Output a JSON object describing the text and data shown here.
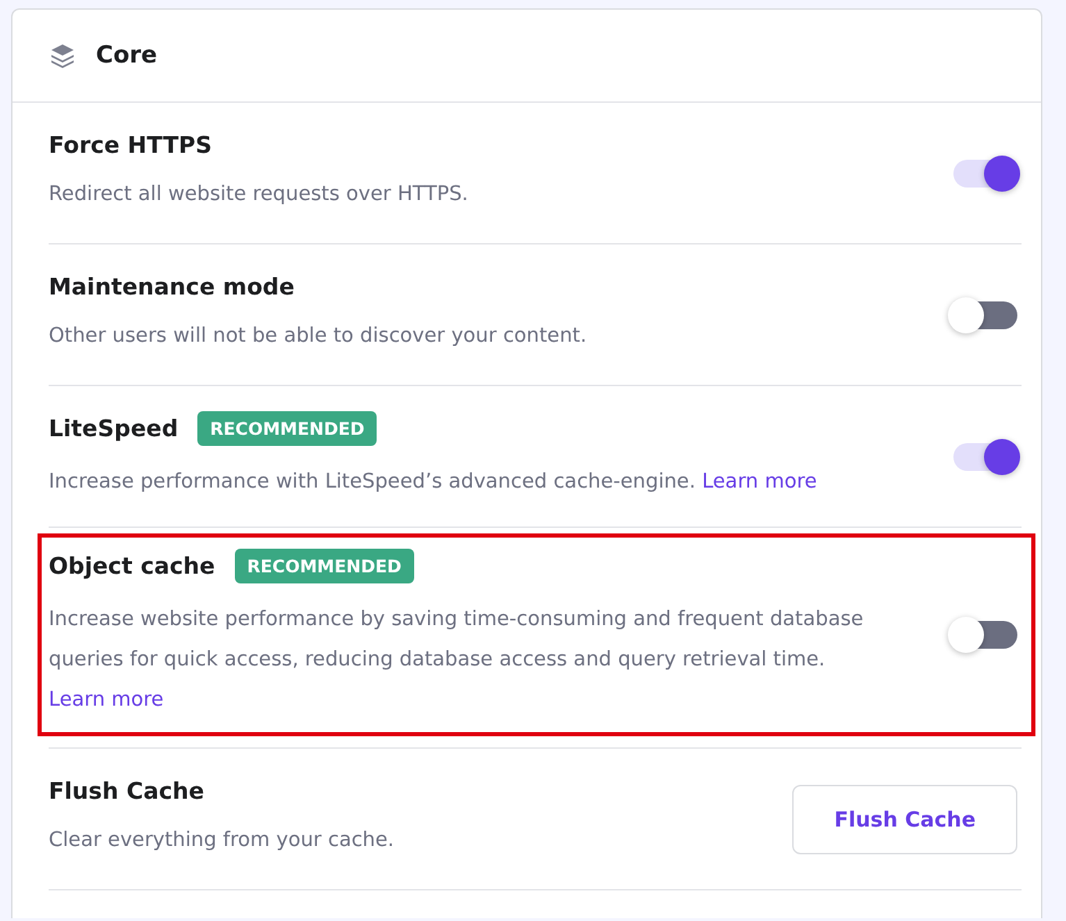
{
  "section": {
    "title": "Core"
  },
  "settings": [
    {
      "kind": "toggle",
      "title": "Force HTTPS",
      "description": "Redirect all website requests over HTTPS.",
      "on": true,
      "highlighted": false
    },
    {
      "kind": "toggle",
      "title": "Maintenance mode",
      "description": "Other users will not be able to discover your content.",
      "on": false,
      "highlighted": false
    },
    {
      "kind": "toggle",
      "title": "LiteSpeed",
      "badge": "RECOMMENDED",
      "description": "Increase performance with LiteSpeed’s advanced cache-engine.",
      "link": "Learn more",
      "on": true,
      "highlighted": false
    },
    {
      "kind": "toggle",
      "title": "Object cache",
      "badge": "RECOMMENDED",
      "description": "Increase website performance by saving time-consuming and frequent database queries for quick access, reducing database access and query retrieval time.",
      "link": "Learn more",
      "on": false,
      "highlighted": true
    },
    {
      "kind": "button",
      "title": "Flush Cache",
      "description": "Clear everything from your cache.",
      "button": "Flush Cache",
      "highlighted": false
    }
  ]
}
